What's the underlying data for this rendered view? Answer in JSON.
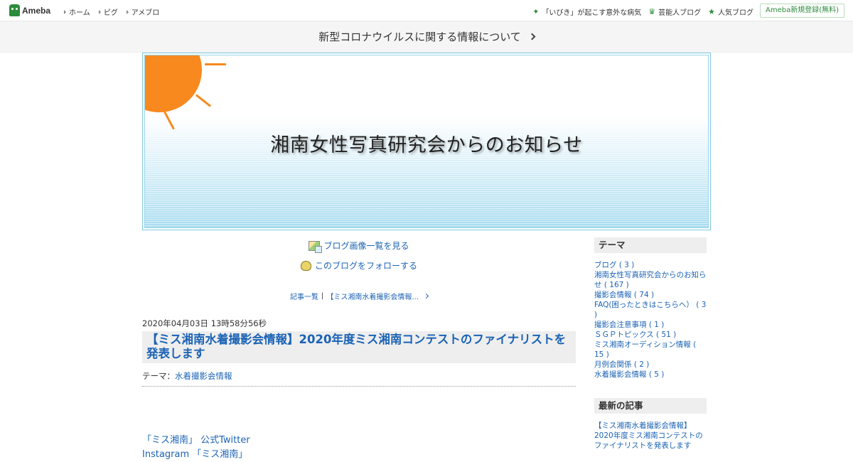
{
  "topbar": {
    "logo": "Ameba",
    "nav": [
      "ホーム",
      "ピグ",
      "アメブロ"
    ],
    "right_links": [
      {
        "label": "「いびき」が起こす意外な病気",
        "icon": "sparkle-icon"
      },
      {
        "label": "芸能人ブログ",
        "icon": "crown-icon"
      },
      {
        "label": "人気ブログ",
        "icon": "star-icon"
      }
    ],
    "signup": "Ameba新規登録(無料)"
  },
  "notice": {
    "text": "新型コロナウイルスに関する情報について"
  },
  "banner": {
    "title": "湘南女性写真研究会からのお知らせ"
  },
  "main": {
    "image_list_link": "ブログ画像一覧を見る",
    "follow_link": "このブログをフォローする",
    "breadcrumb": {
      "list": "記事一覧",
      "separator": "|",
      "current": "【ミス湘南水着撮影会情報..."
    },
    "date": "2020年04月03日 13時58分56秒",
    "title": "【ミス湘南水着撮影会情報】2020年度ミス湘南コンテストのファイナリストを発表します",
    "theme_label": "テーマ：",
    "theme_value": "水着撮影会情報",
    "body_lines": [
      "「ミス湘南」 公式Twitter",
      "Instagram 「ミス湘南」"
    ]
  },
  "sidebar": {
    "theme_heading": "テーマ",
    "themes": [
      "ブログ ( 3 )",
      "湘南女性写真研究会からのお知らせ ( 167 )",
      "撮影会情報 ( 74 )",
      "FAQ(困ったときはこちらへ） ( 3 )",
      "撮影会注意事項 ( 1 )",
      "ＳＧＰトピックス ( 51 )",
      "ミス湘南オーディション情報 ( 15 )",
      "月例会関係 ( 2 )",
      "水着撮影会情報 ( 5 )"
    ],
    "latest_heading": "最新の記事",
    "latest": [
      "【ミス湘南水着撮影会情報】2020年度ミス湘南コンテストのファイナリストを発表します"
    ]
  },
  "colors": {
    "accent_green": "#2d8c3c",
    "link_blue": "#1b63b5",
    "sun_orange": "#f7891e",
    "banner_blue": "#a8dcef"
  }
}
